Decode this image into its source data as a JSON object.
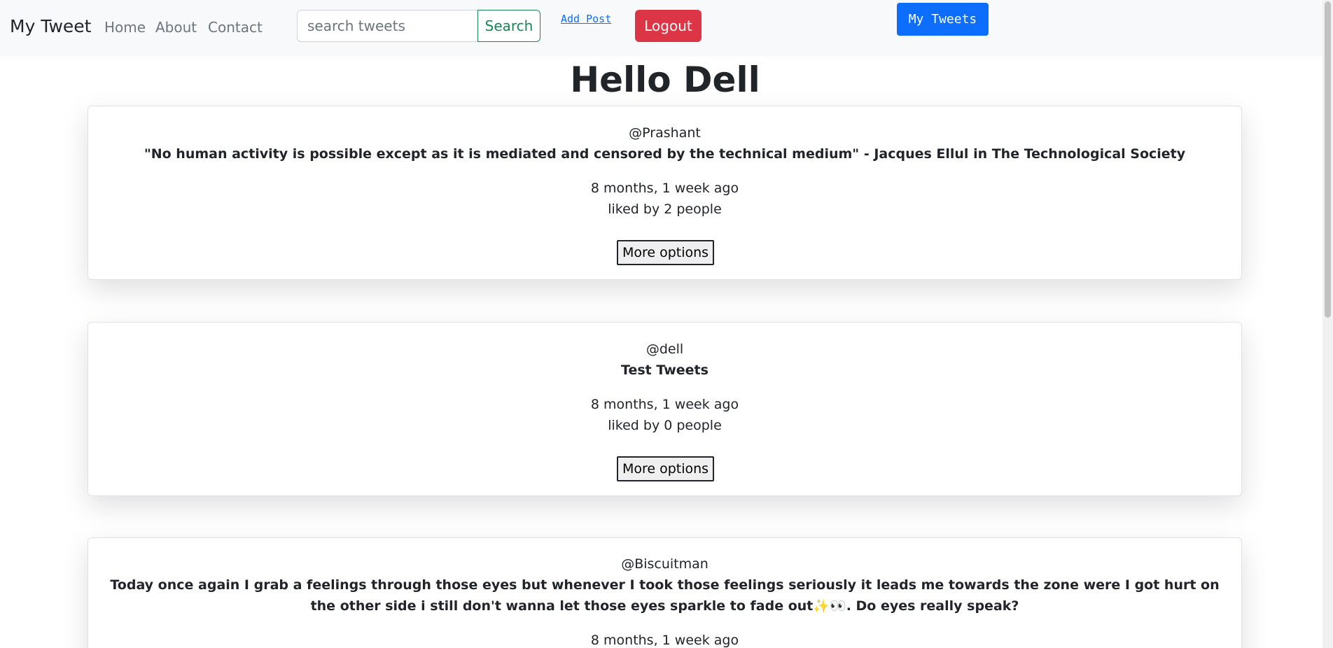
{
  "navbar": {
    "brand": "My Tweet",
    "links": [
      "Home",
      "About",
      "Contact"
    ],
    "search_placeholder": "search tweets",
    "search_label": "Search",
    "add_post_label": "Add Post",
    "logout_label": "Logout",
    "my_tweets_label": "My Tweets"
  },
  "main": {
    "title": "Hello Dell"
  },
  "tweets": [
    {
      "user": "@Prashant",
      "text": "\"No human activity is possible except as it is mediated and censored by the technical medium\" - Jacques Ellul in The Technological Society",
      "time": "8 months, 1 week ago",
      "likes": "liked by 2 people",
      "more_label": "More options"
    },
    {
      "user": "@dell",
      "text": "Test Tweets",
      "time": "8 months, 1 week ago",
      "likes": "liked by 0 people",
      "more_label": "More options"
    },
    {
      "user": "@Biscuitman",
      "text": "Today once again I grab a feelings through those eyes but whenever I took those feelings seriously it leads me towards the zone were I got hurt on the other side i still don't wanna let those eyes sparkle to fade out✨👀. Do eyes really speak?",
      "time": "8 months, 1 week ago"
    }
  ],
  "colors": {
    "navbar_bg": "#f8f9fa",
    "search_green": "#198754",
    "logout_red": "#dc3545",
    "primary_blue": "#0d6efd"
  }
}
